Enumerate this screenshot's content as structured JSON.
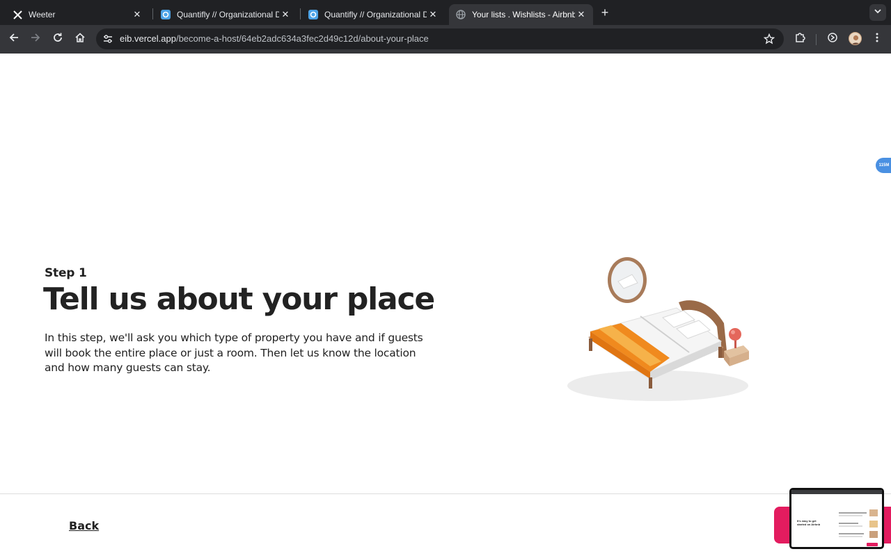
{
  "browser": {
    "tabs": [
      {
        "title": "Weeter",
        "favicon": "x-logo-icon",
        "active": false
      },
      {
        "title": "Quantifly // Organizational Dia",
        "favicon": "quantifly-icon",
        "active": false
      },
      {
        "title": "Quantifly // Organizational Dia",
        "favicon": "quantifly-icon",
        "active": false
      },
      {
        "title": "Your lists . Wishlists - Airbnb",
        "favicon": "globe-icon",
        "active": true
      }
    ],
    "new_tab_glyph": "+",
    "url_host": "eib.vercel.app",
    "url_path": "/become-a-host/64eb2adc634a3fec2d49c12d/about-your-place"
  },
  "page": {
    "step_label": "Step 1",
    "title": "Tell us about your place",
    "description": "In this step, we'll ask you which type of property you have and if guests will book the entire place or just a room. Then let us know the location and how many guests can stay.",
    "back_label": "Back",
    "next_button_color": "#e31c5f"
  },
  "extension_badge": "115M",
  "pip_preview": {
    "text": "It's easy to get started on Airbnb"
  }
}
